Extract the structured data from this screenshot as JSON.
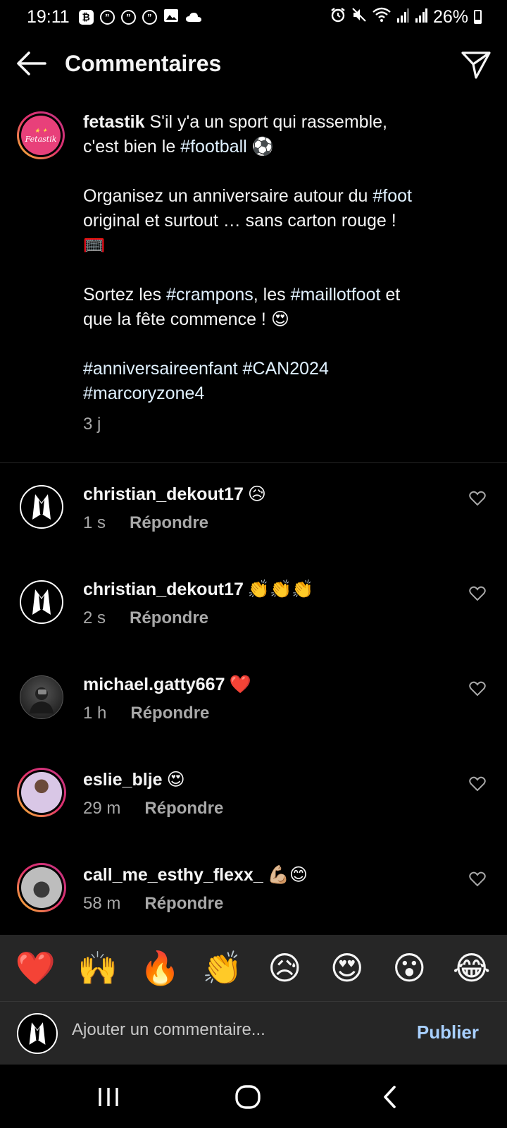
{
  "status_bar": {
    "time": "19:11",
    "battery": "26%",
    "icons": [
      "bitcoin-icon",
      "quote-icon",
      "quote-icon",
      "quote-icon",
      "gallery-icon",
      "cloud-icon",
      "alarm-icon",
      "mute-icon",
      "wifi-icon",
      "signal-icon",
      "signal-icon",
      "battery-icon"
    ]
  },
  "header": {
    "title": "Commentaires"
  },
  "post": {
    "username": "fetastik",
    "avatar_text": "Fetastik",
    "caption_line1": " S'il y'a un sport qui rassemble,",
    "caption_line2a": "c'est bien le ",
    "caption_tag_football": "#football",
    "caption_emoji_ball": " ⚽",
    "caption_p2a": "Organisez un anniversaire autour du ",
    "caption_tag_foot": "#foot",
    "caption_p2b": "original et surtout … sans carton rouge !",
    "caption_emoji_goal": "🥅",
    "caption_p3a": "Sortez les ",
    "caption_tag_crampons": "#crampons",
    "caption_p3b": ", les ",
    "caption_tag_maillot": "#maillotfoot",
    "caption_p3c": " et",
    "caption_p3d": "que la fête commence ! ",
    "caption_emoji_hearteyes": "😍",
    "caption_tag_anniv": "#anniversaireenfant",
    "caption_tag_can": "#CAN2024",
    "caption_tag_marcory": "#marcoryzone4",
    "time": "3 j"
  },
  "comments": [
    {
      "username": "christian_dekout17",
      "emoji": "😥",
      "time": "1 s",
      "reply": "Répondre"
    },
    {
      "username": "christian_dekout17",
      "emoji": "👏👏👏",
      "time": "2 s",
      "reply": "Répondre"
    },
    {
      "username": "michael.gatty667",
      "emoji": "❤️",
      "time": "1 h",
      "reply": "Répondre"
    },
    {
      "username": "eslie_blje",
      "emoji": "😍",
      "time": "29 m",
      "reply": "Répondre"
    },
    {
      "username": "call_me_esthy_flexx_",
      "emoji": "💪🏼😊",
      "time": "58 m",
      "reply": "Répondre"
    }
  ],
  "emoji_bar": [
    "❤️",
    "🙌",
    "🔥",
    "👏",
    "😥",
    "😍",
    "😮",
    "😂"
  ],
  "composer": {
    "placeholder": "Ajouter un commentaire...",
    "publish_label": "Publier"
  },
  "colors": {
    "background": "#000000",
    "panel": "#262626",
    "muted_text": "#a8a8a8",
    "publish": "#a8d0ff"
  }
}
